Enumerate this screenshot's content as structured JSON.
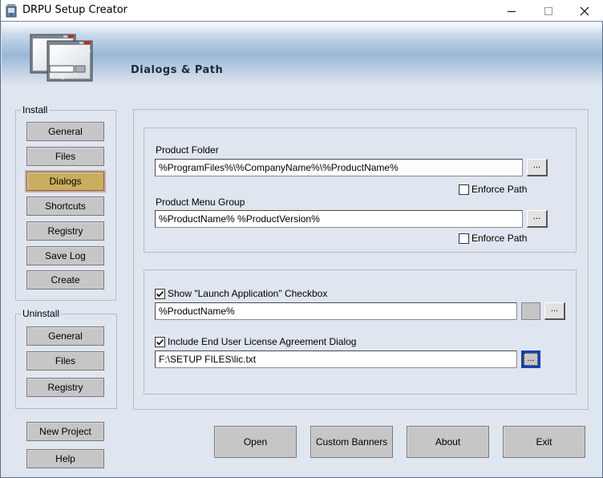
{
  "window": {
    "title": "DRPU Setup Creator",
    "controls": {
      "minimize": "minimize",
      "maximize": "maximize",
      "close": "close"
    }
  },
  "banner": {
    "title": "Dialogs & Path",
    "icon": "dialog-windows-icon"
  },
  "install": {
    "legend": "Install",
    "items": [
      {
        "label": "General",
        "active": false
      },
      {
        "label": "Files",
        "active": false
      },
      {
        "label": "Dialogs",
        "active": true
      },
      {
        "label": "Shortcuts",
        "active": false
      },
      {
        "label": "Registry",
        "active": false
      },
      {
        "label": "Save Log",
        "active": false
      },
      {
        "label": "Create",
        "active": false
      }
    ]
  },
  "uninstall": {
    "legend": "Uninstall",
    "items": [
      {
        "label": "General"
      },
      {
        "label": "Files"
      },
      {
        "label": "Registry"
      }
    ]
  },
  "sidebar_actions": {
    "new_project": "New Project",
    "help": "Help"
  },
  "paths": {
    "product_folder": {
      "label": "Product Folder",
      "value": "%ProgramFiles%\\%CompanyName%\\%ProductName%",
      "browse": "...",
      "enforce_label": "Enforce Path",
      "enforce_checked": false
    },
    "menu_group": {
      "label": "Product Menu Group",
      "value": "%ProductName% %ProductVersion%",
      "browse": "...",
      "enforce_label": "Enforce Path",
      "enforce_checked": false
    }
  },
  "dialogs": {
    "launch_app": {
      "label": "Show \"Launch Application\" Checkbox",
      "checked": true,
      "value": "%ProductName%",
      "browse": "..."
    },
    "eula": {
      "label": "Include End User License Agreement Dialog",
      "checked": true,
      "value": "F:\\SETUP FILES\\lic.txt",
      "browse": "..."
    }
  },
  "footer": {
    "open": "Open",
    "custom_banners": "Custom Banners",
    "about": "About",
    "exit": "Exit"
  }
}
